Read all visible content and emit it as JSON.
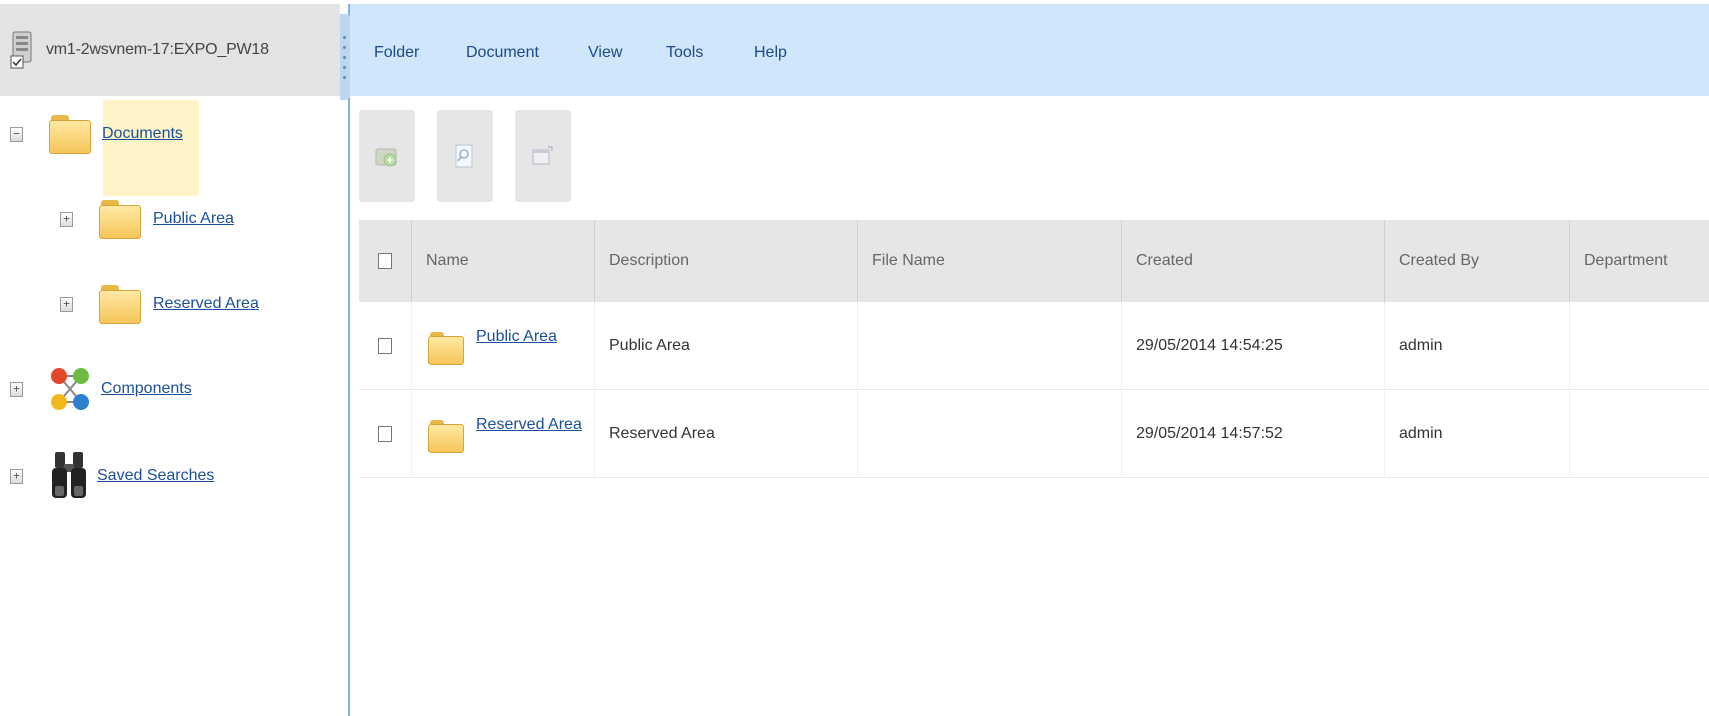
{
  "tree": {
    "server_label": "vm1-2wsvnem-17:EXPO_PW18",
    "nodes": [
      {
        "label": "Documents",
        "expander": "−"
      },
      {
        "label": "Public Area",
        "expander": "+"
      },
      {
        "label": "Reserved Area",
        "expander": "+"
      },
      {
        "label": "Components",
        "expander": "+"
      },
      {
        "label": "Saved Searches",
        "expander": "+"
      }
    ]
  },
  "menu": {
    "items": [
      "Folder",
      "Document",
      "View",
      "Tools",
      "Help"
    ]
  },
  "toolbar": {
    "buttons": [
      "add-folder-icon",
      "search-icon",
      "properties-icon"
    ]
  },
  "grid": {
    "columns": [
      "Name",
      "Description",
      "File Name",
      "Created",
      "Created By",
      "Department"
    ],
    "rows": [
      {
        "name": "Public Area",
        "description": "Public Area",
        "file_name": "",
        "created": "29/05/2014 14:54:25",
        "created_by": "admin",
        "department": ""
      },
      {
        "name": "Reserved Area",
        "description": "Reserved Area",
        "file_name": "",
        "created": "29/05/2014 14:57:52",
        "created_by": "admin",
        "department": ""
      }
    ]
  },
  "colors": {
    "menubar_bg": "#cfe6fb",
    "link": "#1a4f9c",
    "highlight": "#fdf4c8",
    "splitter": "#7fb2e5"
  }
}
